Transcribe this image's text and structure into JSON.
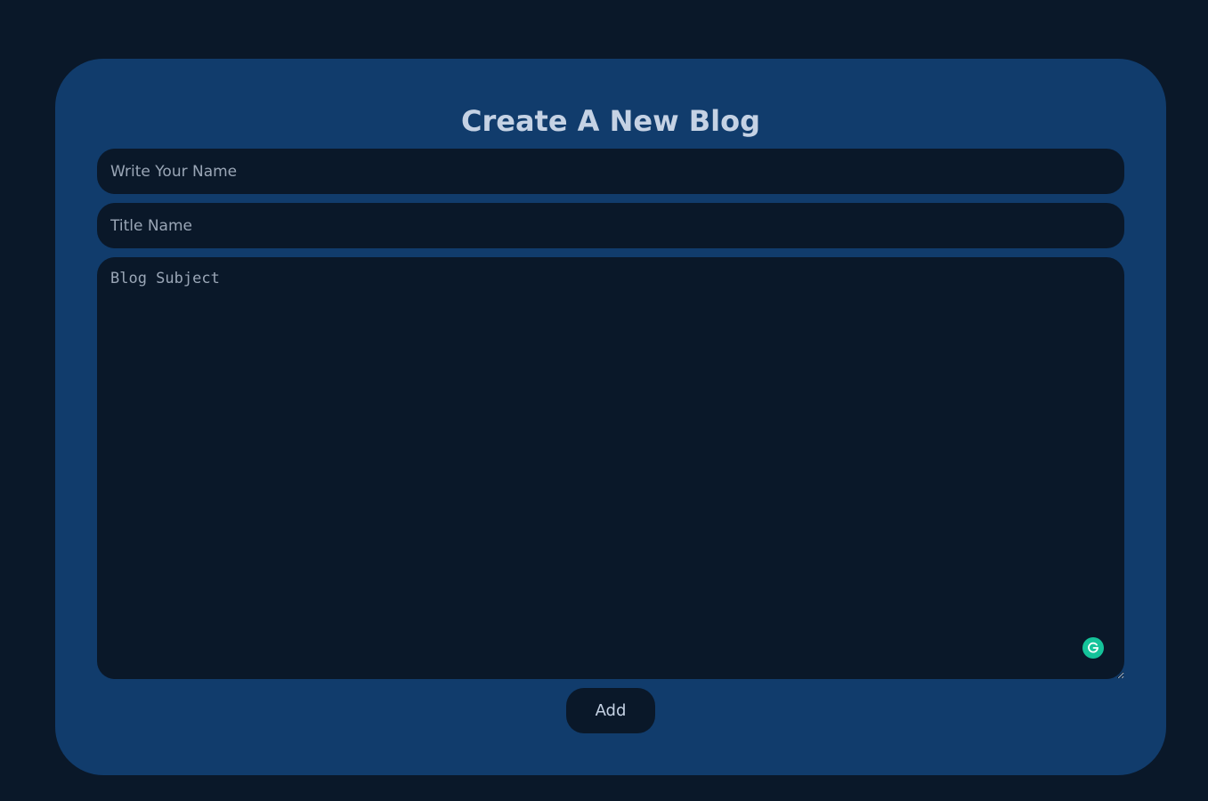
{
  "form": {
    "title": "Create A New Blog",
    "name_placeholder": "Write Your Name",
    "title_placeholder": "Title Name",
    "subject_placeholder": "Blog Subject",
    "add_label": "Add"
  },
  "icons": {
    "grammarly": "grammarly-icon"
  },
  "colors": {
    "page_background": "#0a1829",
    "card_background": "#113c6c",
    "text": "#c5d2e4",
    "placeholder": "#9aa6b6",
    "grammarly": "#15c39a"
  }
}
